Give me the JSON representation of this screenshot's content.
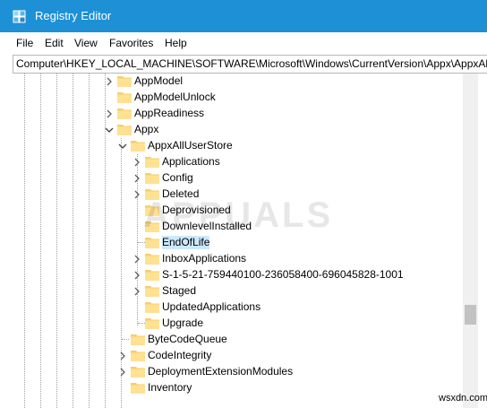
{
  "window": {
    "title": "Registry Editor",
    "titlebar_color": "#1d90d6"
  },
  "menu": {
    "items": [
      "File",
      "Edit",
      "View",
      "Favorites",
      "Help"
    ]
  },
  "address": {
    "path": "Computer\\HKEY_LOCAL_MACHINE\\SOFTWARE\\Microsoft\\Windows\\CurrentVersion\\Appx\\AppxAllUserStore\\EndOfLife"
  },
  "tree": {
    "nodes": [
      {
        "label": "AppModel",
        "expander": "collapsed"
      },
      {
        "label": "AppModelUnlock",
        "expander": "none"
      },
      {
        "label": "AppReadiness",
        "expander": "collapsed"
      },
      {
        "label": "Appx",
        "expander": "expanded"
      },
      {
        "label": "AppxAllUserStore",
        "expander": "expanded"
      },
      {
        "label": "Applications",
        "expander": "collapsed"
      },
      {
        "label": "Config",
        "expander": "collapsed"
      },
      {
        "label": "Deleted",
        "expander": "collapsed"
      },
      {
        "label": "Deprovisioned",
        "expander": "none"
      },
      {
        "label": "DownlevelInstalled",
        "expander": "none"
      },
      {
        "label": "EndOfLife",
        "expander": "none",
        "selected": true
      },
      {
        "label": "InboxApplications",
        "expander": "collapsed"
      },
      {
        "label": "S-1-5-21-759440100-236058400-696045828-1001",
        "expander": "collapsed"
      },
      {
        "label": "Staged",
        "expander": "collapsed"
      },
      {
        "label": "UpdatedApplications",
        "expander": "none"
      },
      {
        "label": "Upgrade",
        "expander": "none"
      },
      {
        "label": "ByteCodeQueue",
        "expander": "none"
      },
      {
        "label": "CodeIntegrity",
        "expander": "collapsed"
      },
      {
        "label": "DeploymentExtensionModules",
        "expander": "collapsed"
      },
      {
        "label": "Inventory",
        "expander": "none"
      }
    ]
  },
  "watermark": {
    "logo_text": "APPUALS",
    "site": "wsxdn.com"
  },
  "colors": {
    "folder": "#f5cf6a",
    "selection": "#cce8ff"
  }
}
